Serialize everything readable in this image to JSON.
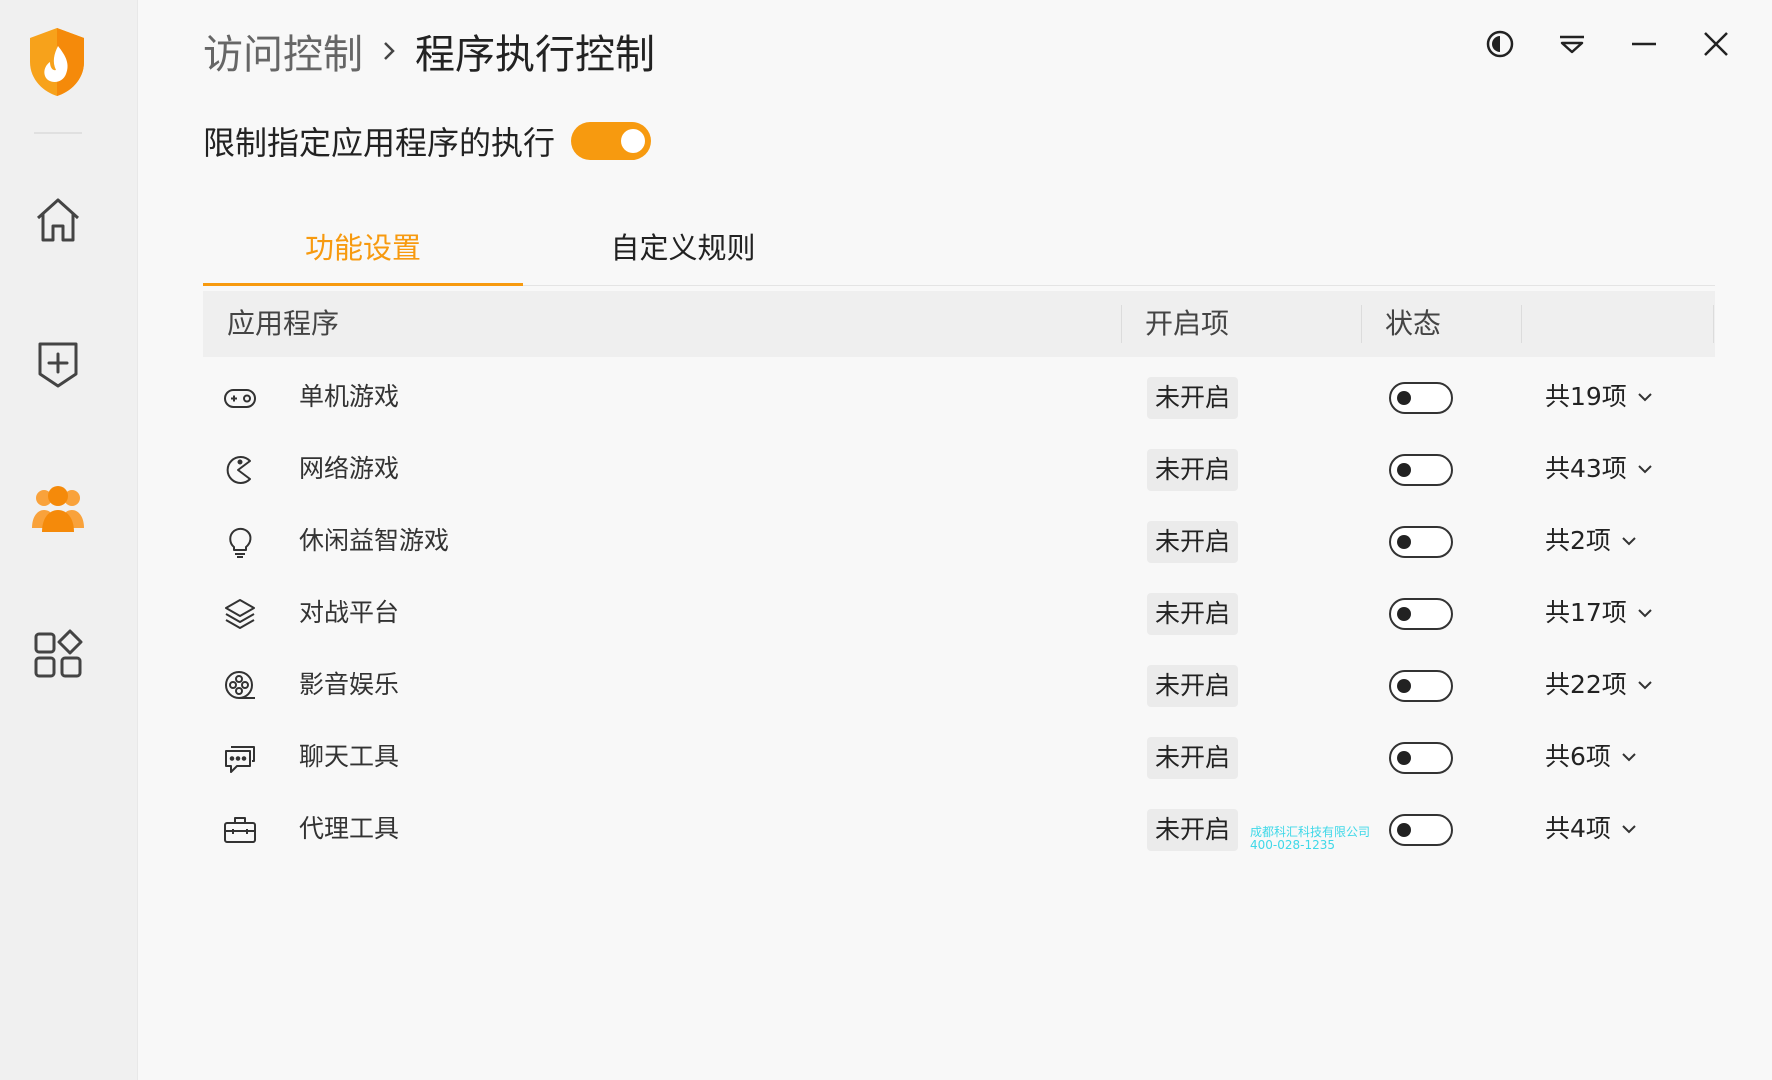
{
  "breadcrumb": {
    "parent": "访问控制",
    "current": "程序执行控制"
  },
  "master": {
    "label": "限制指定应用程序的执行",
    "enabled": true
  },
  "tabs": [
    {
      "label": "功能设置",
      "active": true
    },
    {
      "label": "自定义规则",
      "active": false
    }
  ],
  "table": {
    "headers": [
      "应用程序",
      "开启项",
      "状态"
    ],
    "rows": [
      {
        "icon": "gamepad-icon",
        "name": "单机游戏",
        "badge": "未开启",
        "enabled": false,
        "count": "共19项"
      },
      {
        "icon": "pacman-icon",
        "name": "网络游戏",
        "badge": "未开启",
        "enabled": false,
        "count": "共43项"
      },
      {
        "icon": "lightbulb-icon",
        "name": "休闲益智游戏",
        "badge": "未开启",
        "enabled": false,
        "count": "共2项"
      },
      {
        "icon": "layers-icon",
        "name": "对战平台",
        "badge": "未开启",
        "enabled": false,
        "count": "共17项"
      },
      {
        "icon": "film-reel-icon",
        "name": "影音娱乐",
        "badge": "未开启",
        "enabled": false,
        "count": "共22项"
      },
      {
        "icon": "chat-icon",
        "name": "聊天工具",
        "badge": "未开启",
        "enabled": false,
        "count": "共6项"
      },
      {
        "icon": "toolbox-icon",
        "name": "代理工具",
        "badge": "未开启",
        "enabled": false,
        "count": "共4项"
      }
    ]
  },
  "watermark": {
    "line1": "成都科汇科技有限公司",
    "line2": "400-028-1235"
  },
  "colors": {
    "accent": "#f79a0f"
  }
}
